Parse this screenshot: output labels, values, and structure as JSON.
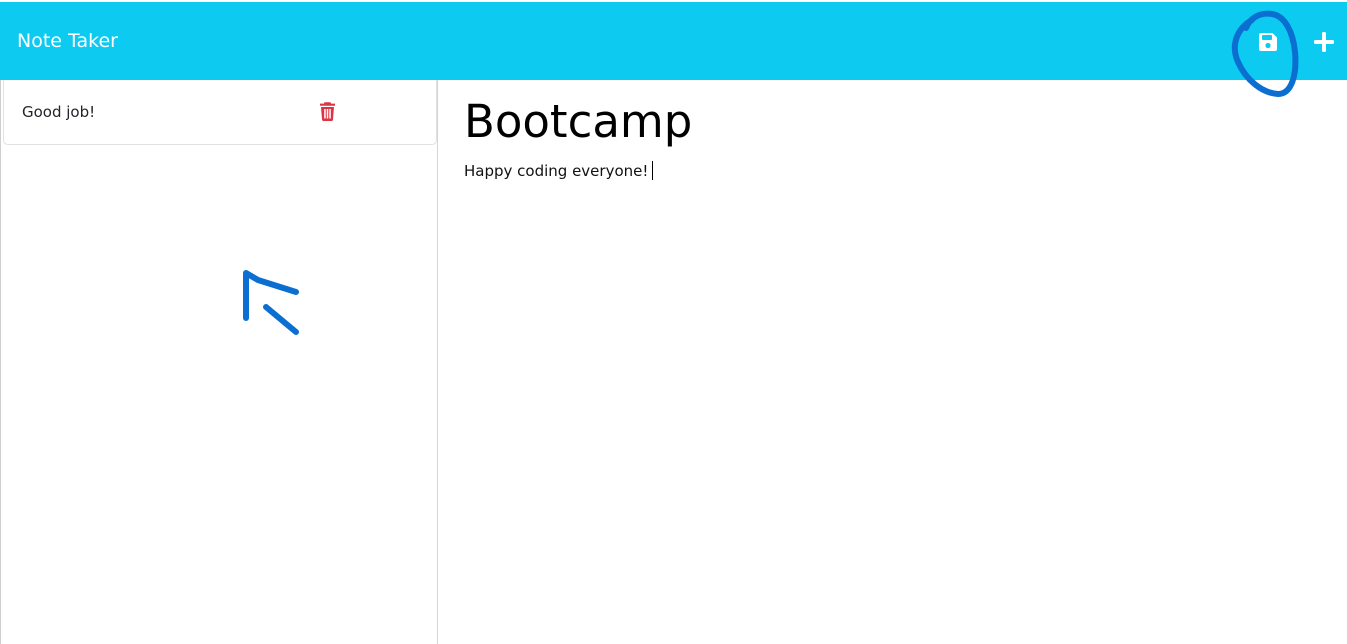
{
  "theme": {
    "accent": "#0dcaf0",
    "danger": "#dc3545",
    "annotation": "#0b6fd1"
  },
  "navbar": {
    "title": "Note Taker",
    "save_icon": "floppy-disk-icon",
    "new_icon": "plus-icon"
  },
  "sidebar": {
    "notes": [
      {
        "title": "Good job!",
        "delete_icon": "trash-icon"
      }
    ]
  },
  "editor": {
    "title": "Bootcamp",
    "text": "Happy coding everyone!"
  }
}
